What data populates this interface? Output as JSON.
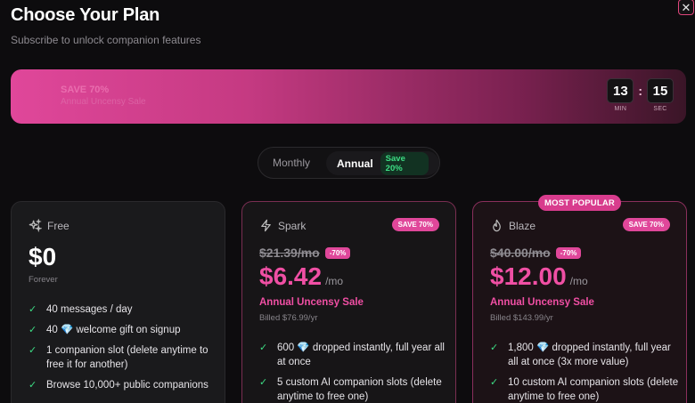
{
  "header": {
    "title": "Choose Your Plan",
    "subtitle": "Subscribe to unlock companion features",
    "close_icon": "close-icon"
  },
  "banner": {
    "line1": "SAVE 70%",
    "line2": "Annual Uncensy Sale",
    "timer": {
      "minutes": "13",
      "seconds": "15",
      "min_label": "MIN",
      "sec_label": "SEC",
      "separator": ":"
    }
  },
  "billing_toggle": {
    "monthly_label": "Monthly",
    "annual_label": "Annual",
    "annual_badge": "Save 20%",
    "selected": "Annual"
  },
  "plans": {
    "free": {
      "name": "Free",
      "icon": "sparkles-icon",
      "price": "$0",
      "period": "Forever",
      "features": [
        "40 messages / day",
        "40 💎 welcome gift on signup",
        "1 companion slot (delete anytime to free it for another)",
        "Browse 10,000+ public companions"
      ]
    },
    "spark": {
      "name": "Spark",
      "icon": "lightning-icon",
      "save_badge": "SAVE 70%",
      "old_price": "$21.39/mo",
      "discount": "-70%",
      "price": "$6.42",
      "per": "/mo",
      "sale_label": "Annual Uncensy Sale",
      "billed": "Billed $76.99/yr",
      "features": [
        "600 💎 dropped instantly, full year all at once",
        "5 custom AI companion slots (delete anytime to free one)"
      ]
    },
    "blaze": {
      "name": "Blaze",
      "icon": "flame-icon",
      "popular_badge": "MOST POPULAR",
      "save_badge": "SAVE 70%",
      "old_price": "$40.00/mo",
      "discount": "-70%",
      "price": "$12.00",
      "per": "/mo",
      "sale_label": "Annual Uncensy Sale",
      "billed": "Billed $143.99/yr",
      "features": [
        "1,800 💎 dropped instantly, full year all at once (3x more value)",
        "10 custom AI companion slots (delete anytime to free one)"
      ]
    }
  },
  "colors": {
    "accent": "#f04fa4",
    "check": "#3ddc84",
    "background": "#0d0c0e"
  }
}
